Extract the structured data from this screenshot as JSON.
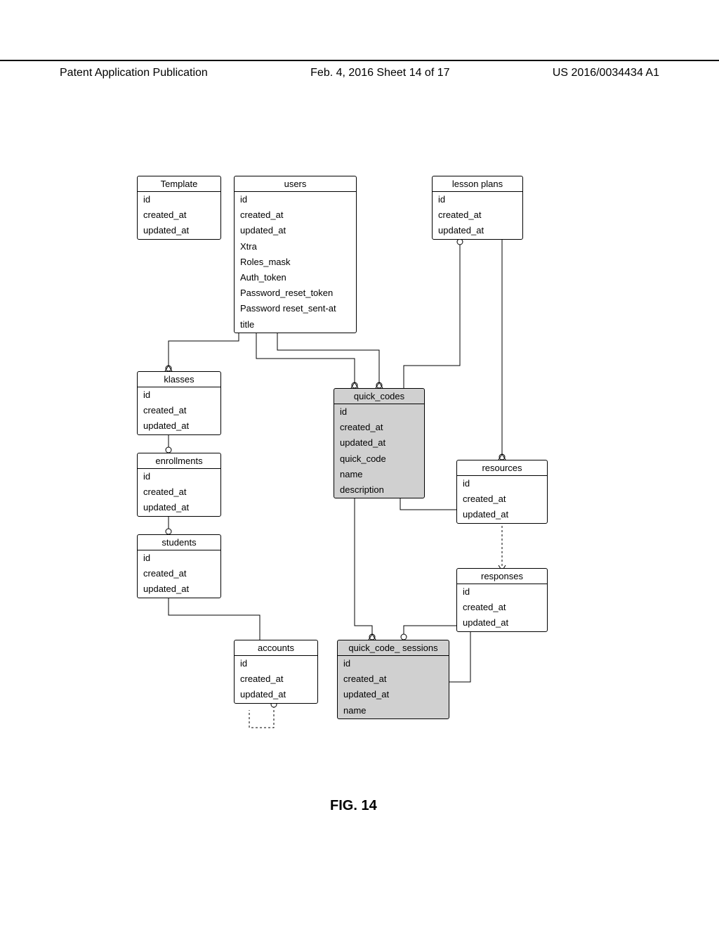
{
  "header": {
    "left": "Patent Application Publication",
    "center": "Feb. 4, 2016   Sheet 14 of 17",
    "right": "US 2016/0034434 A1"
  },
  "entities": {
    "template": {
      "title": "Template",
      "fields": [
        "id",
        "created_at",
        "updated_at"
      ],
      "shaded": false
    },
    "users": {
      "title": "users",
      "fields": [
        "id",
        "created_at",
        "updated_at",
        "Xtra",
        "Roles_mask",
        "Auth_token",
        "Password_reset_token",
        "Password reset_sent-at",
        "title"
      ],
      "shaded": false
    },
    "lesson_plans": {
      "title": "lesson plans",
      "fields": [
        "id",
        "created_at",
        "updated_at"
      ],
      "shaded": false
    },
    "klasses": {
      "title": "klasses",
      "fields": [
        "id",
        "created_at",
        "updated_at"
      ],
      "shaded": false
    },
    "enrollments": {
      "title": "enrollments",
      "fields": [
        "id",
        "created_at",
        "updated_at"
      ],
      "shaded": false
    },
    "students": {
      "title": "students",
      "fields": [
        "id",
        "created_at",
        "updated_at"
      ],
      "shaded": false
    },
    "accounts": {
      "title": "accounts",
      "fields": [
        "id",
        "created_at",
        "updated_at"
      ],
      "shaded": false
    },
    "quick_codes": {
      "title": "quick_codes",
      "fields": [
        "id",
        "created_at",
        "updated_at",
        "quick_code",
        "name",
        "description"
      ],
      "shaded": true
    },
    "quick_code_sessions": {
      "title": "quick_code_ sessions",
      "fields": [
        "id",
        "created_at",
        "updated_at",
        "name"
      ],
      "shaded": true
    },
    "resources": {
      "title": "resources",
      "fields": [
        "id",
        "created_at",
        "updated_at"
      ],
      "shaded": false
    },
    "responses": {
      "title": "responses",
      "fields": [
        "id",
        "created_at",
        "updated_at"
      ],
      "shaded": false
    }
  },
  "figure_label": "FIG. 14"
}
